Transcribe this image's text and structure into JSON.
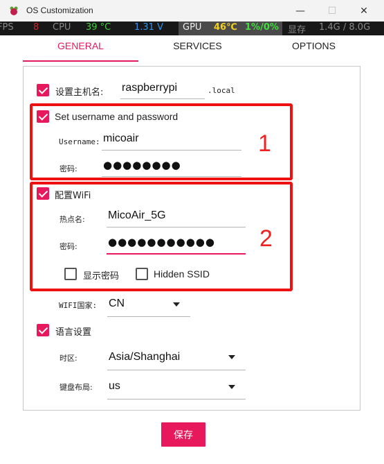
{
  "window": {
    "title": "OS Customization",
    "min_glyph": "—",
    "max_glyph": "☐",
    "close_glyph": "✕"
  },
  "overlay": {
    "fps_label": "FPS",
    "fps_value": "8",
    "cpu_label": "CPU",
    "cpu_temp": "39 °C",
    "cpu_voltage": "1.31 V",
    "gpu_label": "GPU",
    "gpu_temp": "46℃",
    "gpu_usage": "1%/0%",
    "mem_label": "显存",
    "mem_value": "1.4G / 8.0G"
  },
  "tabs": [
    {
      "label": "GENERAL"
    },
    {
      "label": "SERVICES"
    },
    {
      "label": "OPTIONS"
    }
  ],
  "hostname": {
    "label": "设置主机名:",
    "value": "raspberrypi",
    "suffix": ".local"
  },
  "user": {
    "label": "Set username and password",
    "username_label": "Username:",
    "username_value": "micoair",
    "password_label": "密码:",
    "password_dots": "●●●●●●●●"
  },
  "wifi": {
    "label": "配置WiFi",
    "ssid_label": "热点名:",
    "ssid_value": "MicoAir_5G",
    "password_label": "密码:",
    "password_dots": "●●●●●●●●●●●",
    "show_password_label": "显示密码",
    "hidden_ssid_label": "Hidden SSID",
    "country_label": "WIFI国家:",
    "country_value": "CN"
  },
  "locale": {
    "label": "语言设置",
    "timezone_label": "时区:",
    "timezone_value": "Asia/Shanghai",
    "keyboard_label": "键盘布局:",
    "keyboard_value": "us"
  },
  "annotations": {
    "marker_1": "1",
    "marker_2": "2"
  },
  "save_label": "保存",
  "colors": {
    "accent": "#e8185c",
    "annotation_red": "#ee1111"
  }
}
